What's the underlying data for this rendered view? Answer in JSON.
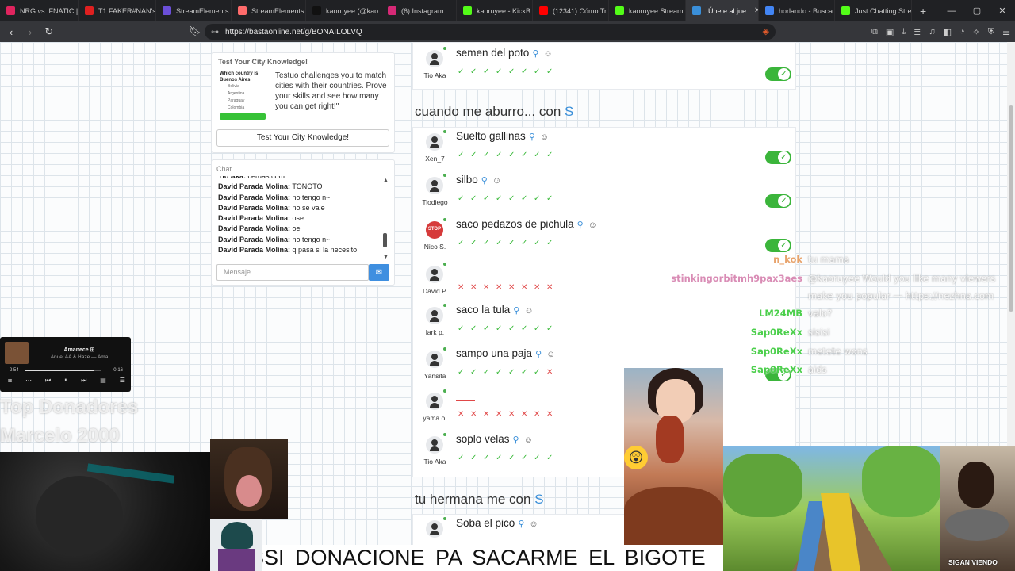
{
  "browser": {
    "tabs": [
      {
        "label": "NRG vs. FNATIC |",
        "color": "#e0245e"
      },
      {
        "label": "T1 FAKER#NAN's",
        "color": "#e02020"
      },
      {
        "label": "StreamElements",
        "color": "#6b4fd8"
      },
      {
        "label": "StreamElements",
        "color": "#ff6b6b"
      },
      {
        "label": "kaoruyee (@kao",
        "color": "#111111"
      },
      {
        "label": "(6) Instagram",
        "color": "#d62976"
      },
      {
        "label": "kaoruyee - KickB",
        "color": "#53fc18"
      },
      {
        "label": "(12341) Cómo Tr",
        "color": "#ff0000"
      },
      {
        "label": "kaoruyee Stream",
        "color": "#53fc18"
      },
      {
        "label": "¡Únete al jue",
        "color": "#3a8fd9",
        "active": true
      },
      {
        "label": "horlando - Busca",
        "color": "#4285f4"
      },
      {
        "label": "Just Chatting Stre",
        "color": "#53fc18"
      }
    ],
    "new_tab": "+",
    "url": "https://bastaonline.net/g/BONAILOLVQ"
  },
  "promo": {
    "title": "Test Your City Knowledge!",
    "img_question": "Which country is Buenos Aires",
    "img_options": [
      "Bolivia",
      "Argentina",
      "Paraguay",
      "Colombia"
    ],
    "description": "Testuo challenges you to match cities with their countries. Prove your skills and see how many you can get right!\"",
    "button": "Test Your City Knowledge!"
  },
  "chat": {
    "title": "Chat",
    "messages": [
      {
        "user": "Tio Aka:",
        "text": "cerdas.com"
      },
      {
        "user": "David Parada Molina:",
        "text": "TONOTO"
      },
      {
        "user": "David Parada Molina:",
        "text": "no tengo n~"
      },
      {
        "user": "David Parada Molina:",
        "text": "no se vale"
      },
      {
        "user": "David Parada Molina:",
        "text": "ose"
      },
      {
        "user": "David Parada Molina:",
        "text": "oe"
      },
      {
        "user": "David Parada Molina:",
        "text": "no tengo n~"
      },
      {
        "user": "David Parada Molina:",
        "text": "q pasa si la necesito"
      }
    ],
    "input_placeholder": "Mensaje ..."
  },
  "sections": [
    {
      "category": "",
      "letter": "",
      "rows": [
        {
          "player": "Tio Aka",
          "answer": "semen del poto",
          "valid": true,
          "votes": [
            1,
            1,
            1,
            1,
            1,
            1,
            1,
            1
          ],
          "toggle": true
        }
      ]
    },
    {
      "category": "cuando me aburro... con",
      "letter": "S",
      "rows": [
        {
          "player": "Xen_7",
          "answer": "Suelto gallinas",
          "valid": true,
          "votes": [
            1,
            1,
            1,
            1,
            1,
            1,
            1,
            1
          ],
          "toggle": true
        },
        {
          "player": "Tiodiego",
          "answer": "silbo",
          "valid": true,
          "votes": [
            1,
            1,
            1,
            1,
            1,
            1,
            1,
            1
          ],
          "toggle": true
        },
        {
          "player": "Nico S.",
          "answer": "saco pedazos de pichula",
          "valid": true,
          "votes": [
            1,
            1,
            1,
            1,
            1,
            1,
            1,
            1
          ],
          "toggle": true,
          "stop": true
        },
        {
          "player": "David P.",
          "answer": "",
          "valid": false,
          "votes": [
            0,
            0,
            0,
            0,
            0,
            0,
            0,
            0
          ],
          "toggle": false
        },
        {
          "player": "lark p.",
          "answer": "saco la tula",
          "valid": true,
          "votes": [
            1,
            1,
            1,
            1,
            1,
            1,
            1,
            1
          ],
          "toggle": false
        },
        {
          "player": "Yansita",
          "answer": "sampo una paja",
          "valid": true,
          "votes": [
            1,
            1,
            1,
            1,
            1,
            1,
            1,
            0
          ],
          "toggle": true
        },
        {
          "player": "yama o.",
          "answer": "",
          "valid": false,
          "votes": [
            0,
            0,
            0,
            0,
            0,
            0,
            0,
            0
          ],
          "toggle": false
        },
        {
          "player": "Tio Aka",
          "answer": "soplo velas",
          "valid": true,
          "votes": [
            1,
            1,
            1,
            1,
            1,
            1,
            1,
            1
          ],
          "toggle": false
        }
      ]
    },
    {
      "category": "tu hermana me con",
      "letter": "S",
      "rows": [
        {
          "player": "",
          "answer": "Soba el pico",
          "valid": true,
          "votes": [],
          "toggle": false
        }
      ]
    }
  ],
  "stream_chat": [
    {
      "user": "n_kok",
      "text": "tu mama",
      "color": "#e8a36b"
    },
    {
      "user": "stinkingorbitmh9pax3aes",
      "text": "@kaoruyee Would you like many viewers",
      "color": "#d98cb5"
    },
    {
      "user": "",
      "text": "make you popular ― https://nezhna.com",
      "color": "#d98cb5"
    },
    {
      "user": "LM24MB",
      "text": "valo?",
      "color": "#4ccf4c"
    },
    {
      "user": "Sap0ReXx",
      "text": "sisisi",
      "color": "#4ccf4c"
    },
    {
      "user": "Sap0ReXx",
      "text": "metete wons",
      "color": "#4ccf4c"
    },
    {
      "user": "Sap0ReXx",
      "text": "aids",
      "color": "#4ccf4c"
    }
  ],
  "media_player": {
    "title": "Amanece ⊞",
    "artist": "Anuel AA & Haze — Ama",
    "elapsed": "2:54",
    "remaining": "-0:16",
    "progress": 0.92
  },
  "ghost_text": [
    "Top Donadores",
    "Marcelo 2000"
  ],
  "ticker": "SSI    DONACIONE PA SACARME EL BIGOTE",
  "sigan": "SIGAN VIENDO"
}
